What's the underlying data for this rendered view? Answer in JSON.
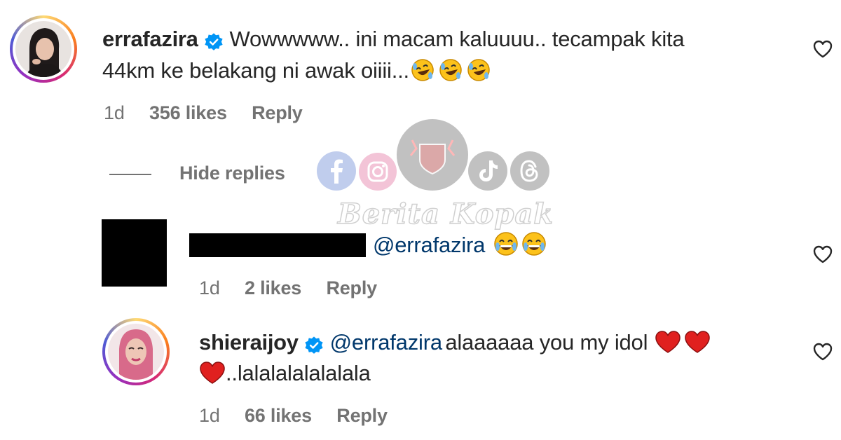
{
  "comments": [
    {
      "username": "errafazira",
      "verified": true,
      "text_line1": "Wowwwww.. ini macam kaluuuu.. tecampak kita",
      "text_line2": "44km ke belakang ni awak oiiii...",
      "emojis": [
        "rofl-emoji",
        "rofl-emoji",
        "rofl-emoji"
      ],
      "time": "1d",
      "likes": "356 likes",
      "reply": "Reply"
    }
  ],
  "hide_replies": "Hide replies",
  "replies": [
    {
      "username_redacted": true,
      "mention": "@errafazira",
      "emojis": [
        "grinning-sweat-emoji",
        "grinning-sweat-emoji"
      ],
      "time": "1d",
      "likes": "2 likes",
      "reply": "Reply"
    },
    {
      "username": "shieraijoy",
      "verified": true,
      "mention": "@errafazira",
      "text_line1": "alaaaaaa you my idol",
      "text_line2": "..lalalalalalalala",
      "emojis": [
        "red-heart-emoji",
        "red-heart-emoji",
        "red-heart-emoji"
      ],
      "time": "1d",
      "likes": "66 likes",
      "reply": "Reply"
    }
  ],
  "watermark": {
    "text": "Berita Kopak",
    "icons": [
      "facebook-icon",
      "instagram-icon",
      "logo-badge",
      "tiktok-icon",
      "threads-icon"
    ]
  },
  "colors": {
    "verified_blue": "#0095f6",
    "mention_blue": "#00376b",
    "meta_gray": "#737373",
    "heart_red": "#e0201f"
  }
}
